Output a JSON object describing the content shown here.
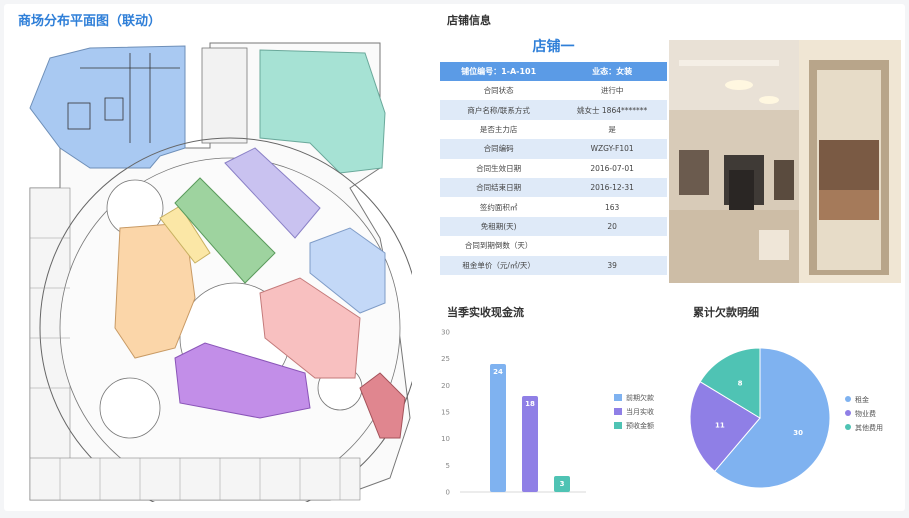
{
  "map": {
    "title": "商场分布平面图（联动）"
  },
  "shop": {
    "section_title": "店铺信息",
    "store_name": "店铺一",
    "header": {
      "col1": "铺位编号：1-A-101",
      "col2": "业态：女装"
    },
    "rows": [
      {
        "label": "合同状态",
        "value": "进行中"
      },
      {
        "label": "商户名称/联系方式",
        "value": "姚女士 1864*******"
      },
      {
        "label": "是否主力店",
        "value": "是"
      },
      {
        "label": "合同编码",
        "value": "WZGY-F101"
      },
      {
        "label": "合同生效日期",
        "value": "2016-07-01"
      },
      {
        "label": "合同结束日期",
        "value": "2016-12-31"
      },
      {
        "label": "签约面积㎡",
        "value": "163"
      },
      {
        "label": "免租期(天)",
        "value": "20"
      },
      {
        "label": "合同到期倒数（天）",
        "value": ""
      },
      {
        "label": "租金单价（元/㎡/天）",
        "value": "39"
      }
    ]
  },
  "cashflow": {
    "title": "当季实收现金流",
    "colors": [
      "#7fb2f0",
      "#8f7fe6",
      "#4fc3b4"
    ],
    "chart_data": {
      "type": "bar",
      "categories": [
        "前期欠款",
        "当月实收",
        "预收金额"
      ],
      "values": [
        24,
        18,
        3
      ],
      "ylim": [
        0,
        30
      ],
      "yticks": [
        "0",
        "5",
        "10",
        "15",
        "20",
        "25",
        "30"
      ],
      "legend": "right",
      "grid": false
    }
  },
  "arrears": {
    "title": "累计欠款明细",
    "colors": [
      "#7fb2f0",
      "#8f7fe6",
      "#4fc3b4"
    ],
    "chart_data": {
      "type": "pie",
      "labels": [
        "租金",
        "物业费",
        "其他费用"
      ],
      "values": [
        30,
        11,
        8
      ],
      "legend": "right"
    }
  }
}
